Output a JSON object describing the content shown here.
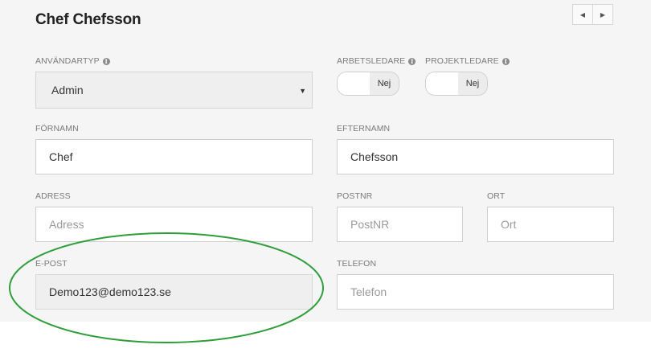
{
  "header": {
    "title": "Chef Chefsson"
  },
  "pager": {
    "prev_icon": "caret-left-icon",
    "next_icon": "caret-right-icon",
    "prev_glyph": "◀",
    "next_glyph": "▶"
  },
  "form": {
    "anvandartyp": {
      "label": "ANVÄNDARTYP",
      "value": "Admin"
    },
    "arbetsledare": {
      "label": "ARBETSLEDARE",
      "state": "Nej"
    },
    "projektledare": {
      "label": "PROJEKTLEDARE",
      "state": "Nej"
    },
    "fornamn": {
      "label": "FÖRNAMN",
      "value": "Chef"
    },
    "efternamn": {
      "label": "EFTERNAMN",
      "value": "Chefsson"
    },
    "adress": {
      "label": "ADRESS",
      "placeholder": "Adress"
    },
    "postnr": {
      "label": "POSTNR",
      "placeholder": "PostNR"
    },
    "ort": {
      "label": "ORT",
      "placeholder": "Ort"
    },
    "epost": {
      "label": "E-POST",
      "value": "Demo123@demo123.se"
    },
    "telefon": {
      "label": "TELEFON",
      "placeholder": "Telefon"
    }
  },
  "info_glyph": "i",
  "annotation": {
    "color": "#2e9e3a"
  }
}
